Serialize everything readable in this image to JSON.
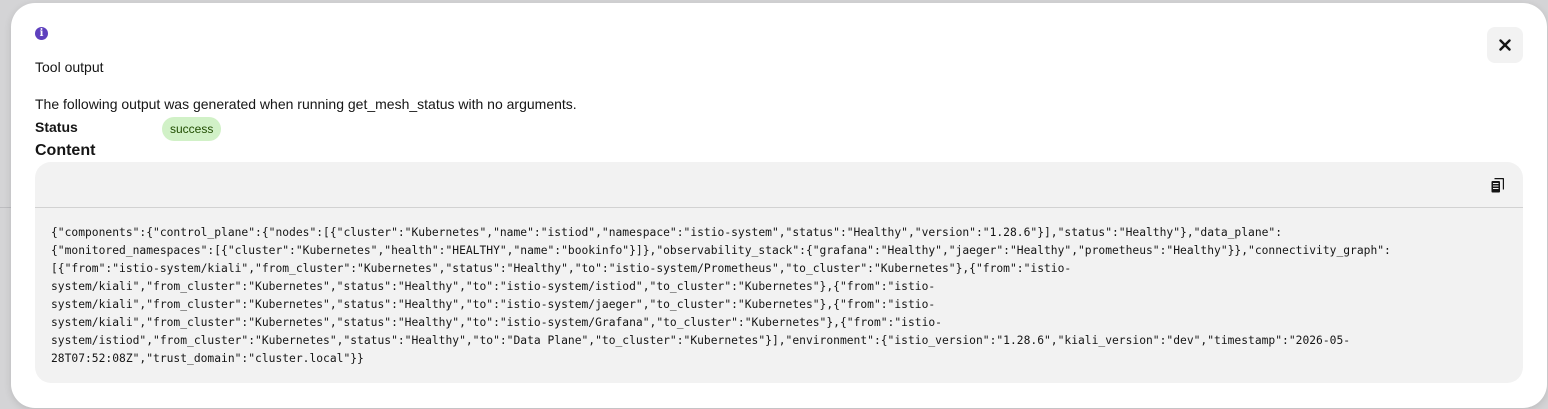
{
  "modal": {
    "title": "Tool output",
    "description": "The following output was generated when running get_mesh_status with no arguments.",
    "status_label": "Status",
    "status_value": "success",
    "content_heading": "Content",
    "content_lines": [
      "{\"components\":{\"control_plane\":{\"nodes\":[{\"cluster\":\"Kubernetes\",\"name\":\"istiod\",\"namespace\":\"istio-system\",\"status\":\"Healthy\",\"version\":\"1.28.6\"}],\"status\":\"Healthy\"},\"data_plane\":",
      "{\"monitored_namespaces\":[{\"cluster\":\"Kubernetes\",\"health\":\"HEALTHY\",\"name\":\"bookinfo\"}]},\"observability_stack\":{\"grafana\":\"Healthy\",\"jaeger\":\"Healthy\",\"prometheus\":\"Healthy\"}},\"connectivity_graph\":",
      "[{\"from\":\"istio-system/kiali\",\"from_cluster\":\"Kubernetes\",\"status\":\"Healthy\",\"to\":\"istio-system/Prometheus\",\"to_cluster\":\"Kubernetes\"},{\"from\":\"istio-",
      "system/kiali\",\"from_cluster\":\"Kubernetes\",\"status\":\"Healthy\",\"to\":\"istio-system/istiod\",\"to_cluster\":\"Kubernetes\"},{\"from\":\"istio-",
      "system/kiali\",\"from_cluster\":\"Kubernetes\",\"status\":\"Healthy\",\"to\":\"istio-system/jaeger\",\"to_cluster\":\"Kubernetes\"},{\"from\":\"istio-",
      "system/kiali\",\"from_cluster\":\"Kubernetes\",\"status\":\"Healthy\",\"to\":\"istio-system/Grafana\",\"to_cluster\":\"Kubernetes\"},{\"from\":\"istio-",
      "system/istiod\",\"from_cluster\":\"Kubernetes\",\"status\":\"Healthy\",\"to\":\"Data Plane\",\"to_cluster\":\"Kubernetes\"}],\"environment\":{\"istio_version\":\"1.28.6\",\"kiali_version\":\"dev\",\"timestamp\":\"2026-05-",
      "28T07:52:08Z\",\"trust_domain\":\"cluster.local\"}}"
    ]
  },
  "icons": {
    "info": "info-circle-icon",
    "close": "close-icon",
    "copy": "copy-icon"
  },
  "colors": {
    "accent": "#5e40be",
    "success_bg": "#d1f1c7",
    "code_bg": "#f2f2f2"
  }
}
